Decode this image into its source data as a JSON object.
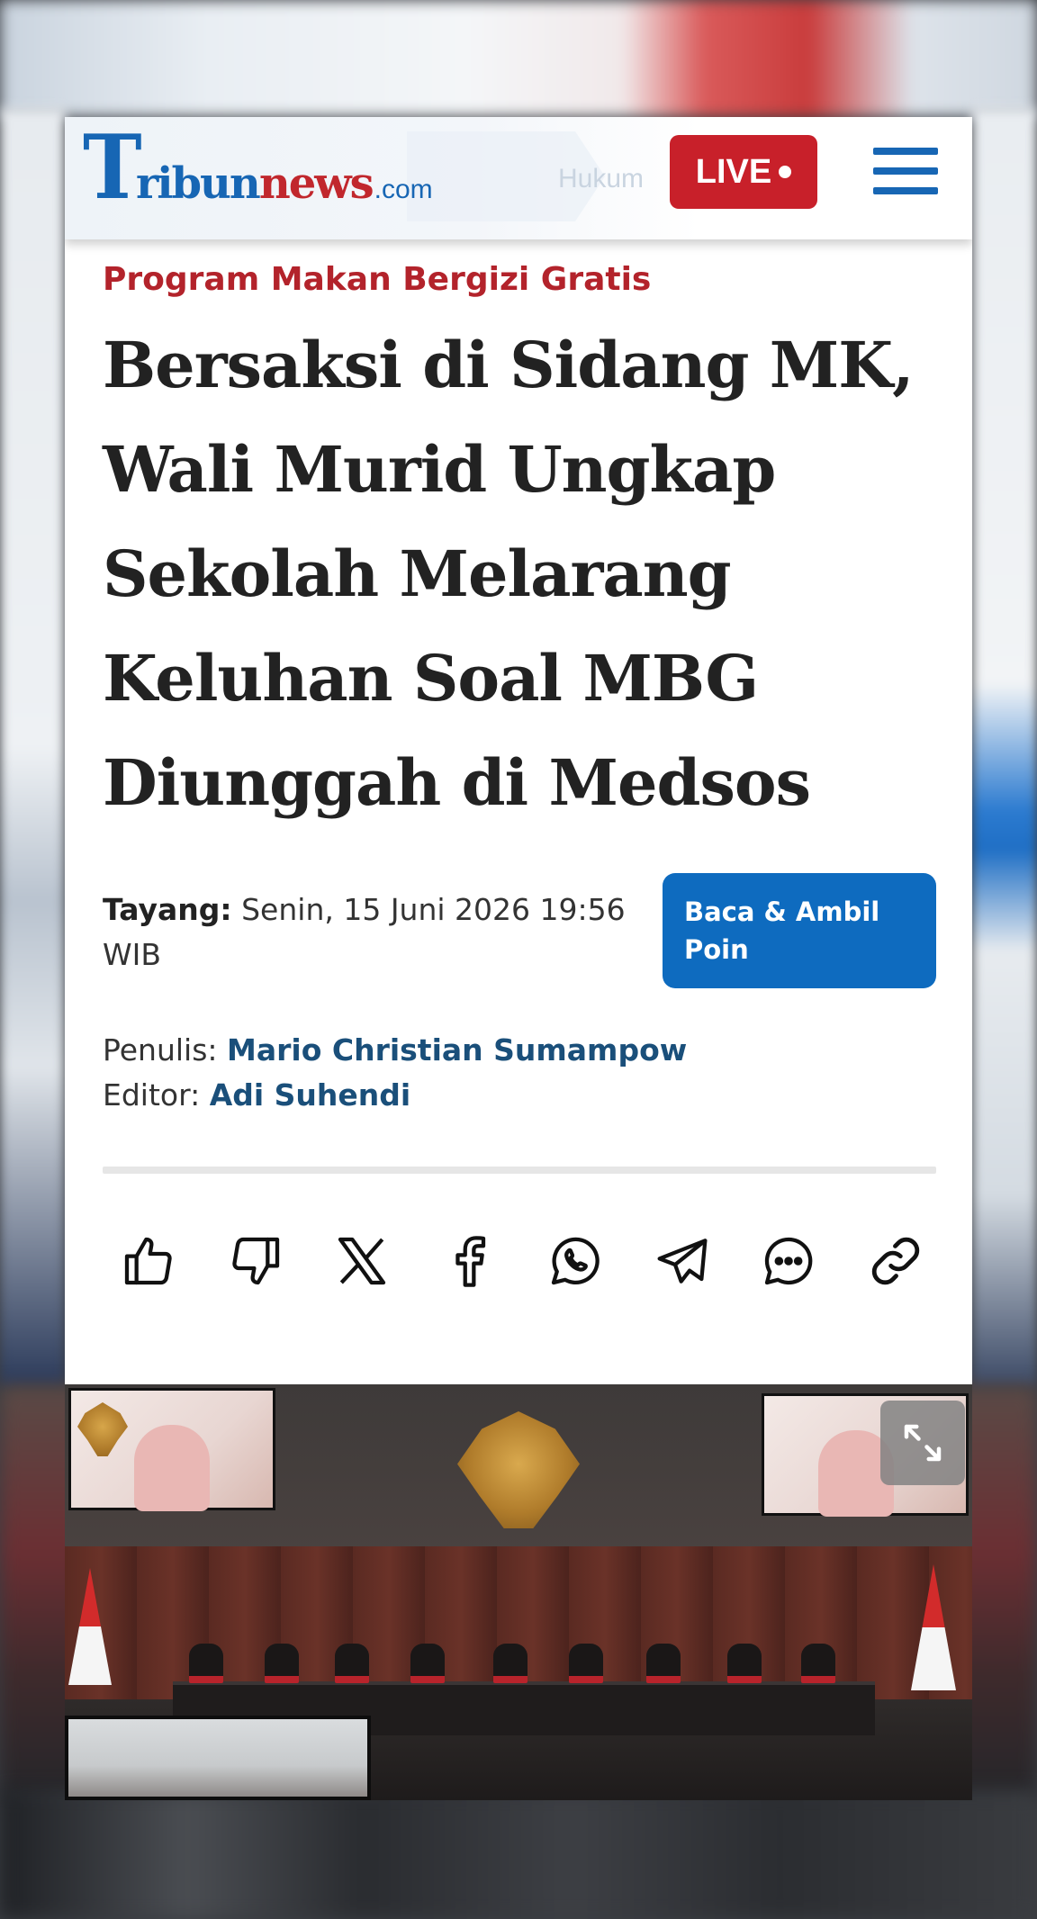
{
  "header": {
    "logo": {
      "t": "T",
      "ribun": "ribun",
      "news": "news",
      "com": ".com"
    },
    "ghost_nav_text": "Hukum",
    "live_label": "LIVE",
    "menu_icon": "hamburger-menu-icon"
  },
  "article": {
    "category": "Program Makan Bergizi Gratis",
    "title": "Bersaksi di Sidang MK, Wali Murid Ungkap Sekolah Melarang Keluhan Soal MBG Diunggah di Medsos",
    "publish_label": "Tayang:",
    "publish_value": "Senin, 15 Juni 2026 19:56 WIB",
    "read_button_label": "Baca & Ambil Poin",
    "writer_label": "Penulis:",
    "writer_name": "Mario Christian Sumampow",
    "editor_label": "Editor:",
    "editor_name": "Adi Suhendi"
  },
  "share": {
    "icons": [
      "thumbs-up-icon",
      "thumbs-down-icon",
      "x-icon",
      "facebook-icon",
      "whatsapp-icon",
      "telegram-icon",
      "comment-icon",
      "link-icon"
    ]
  },
  "video": {
    "expand_icon": "expand-icon"
  },
  "colors": {
    "brand_blue": "#1766b4",
    "brand_red": "#c1272d",
    "category_red": "#b3232b",
    "live_red": "#c8202a",
    "button_blue": "#0e6bbf",
    "author_blue": "#1a4f7a"
  }
}
